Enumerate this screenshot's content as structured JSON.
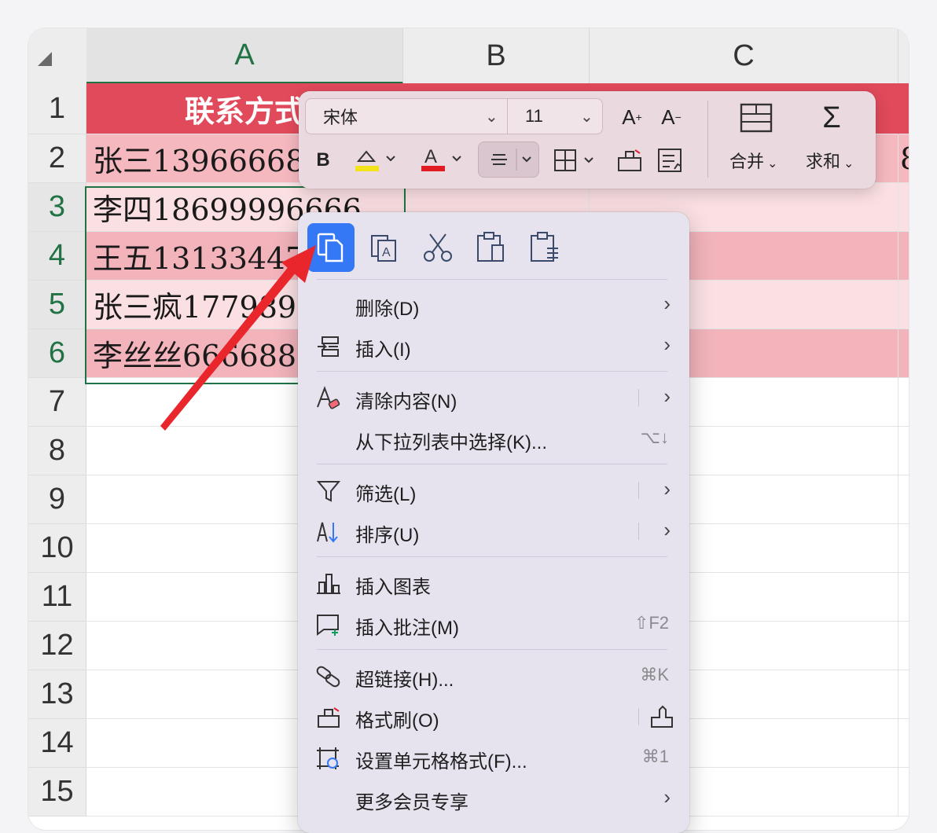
{
  "columns": [
    "A",
    "B",
    "C"
  ],
  "rows": [
    "1",
    "2",
    "3",
    "4",
    "5",
    "6",
    "7",
    "8",
    "9",
    "10",
    "11",
    "12",
    "13",
    "14",
    "15"
  ],
  "cells": {
    "a1": "联系方式",
    "a2": "张三13966668888",
    "c2": "8",
    "a3": "李四18699996666",
    "a4": "王五13133447777",
    "a5": "张三疯17798989898",
    "a6": "李丝丝6666888888"
  },
  "toolbar": {
    "font_name": "宋体",
    "font_size": "11",
    "bold_label": "B",
    "merge_label": "合并",
    "sum_label": "求和"
  },
  "menu": {
    "top_icons": [
      "copy-icon",
      "copy-as-picture-icon",
      "cut-icon",
      "paste-icon",
      "paste-special-icon"
    ],
    "items": [
      {
        "label": "删除(D)",
        "shortcut": "",
        "arrow": "›"
      },
      {
        "label": "插入(I)",
        "shortcut": "",
        "arrow": "›"
      },
      {
        "label": "清除内容(N)",
        "shortcut": "",
        "arrow": "›"
      },
      {
        "label": "从下拉列表中选择(K)...",
        "shortcut": "⌥↓",
        "arrow": ""
      },
      {
        "label": "筛选(L)",
        "shortcut": "",
        "arrow": "›"
      },
      {
        "label": "排序(U)",
        "shortcut": "",
        "arrow": "›"
      },
      {
        "label": "插入图表",
        "shortcut": "",
        "arrow": ""
      },
      {
        "label": "插入批注(M)",
        "shortcut": "⇧F2",
        "arrow": ""
      },
      {
        "label": "超链接(H)...",
        "shortcut": "⌘K",
        "arrow": ""
      },
      {
        "label": "格式刷(O)",
        "shortcut": "",
        "arrow": ""
      },
      {
        "label": "设置单元格格式(F)...",
        "shortcut": "⌘1",
        "arrow": ""
      },
      {
        "label": "更多会员专享",
        "shortcut": "",
        "arrow": "›"
      }
    ]
  },
  "colors": {
    "header_red": "#e14a5b",
    "row2_fill": "#f5b8bf",
    "row_light": "#fbe0e3",
    "row_mid": "#f2b3bb",
    "selection": "#217346",
    "accent_blue": "#3478f6",
    "arrow_red": "#e8262b"
  }
}
